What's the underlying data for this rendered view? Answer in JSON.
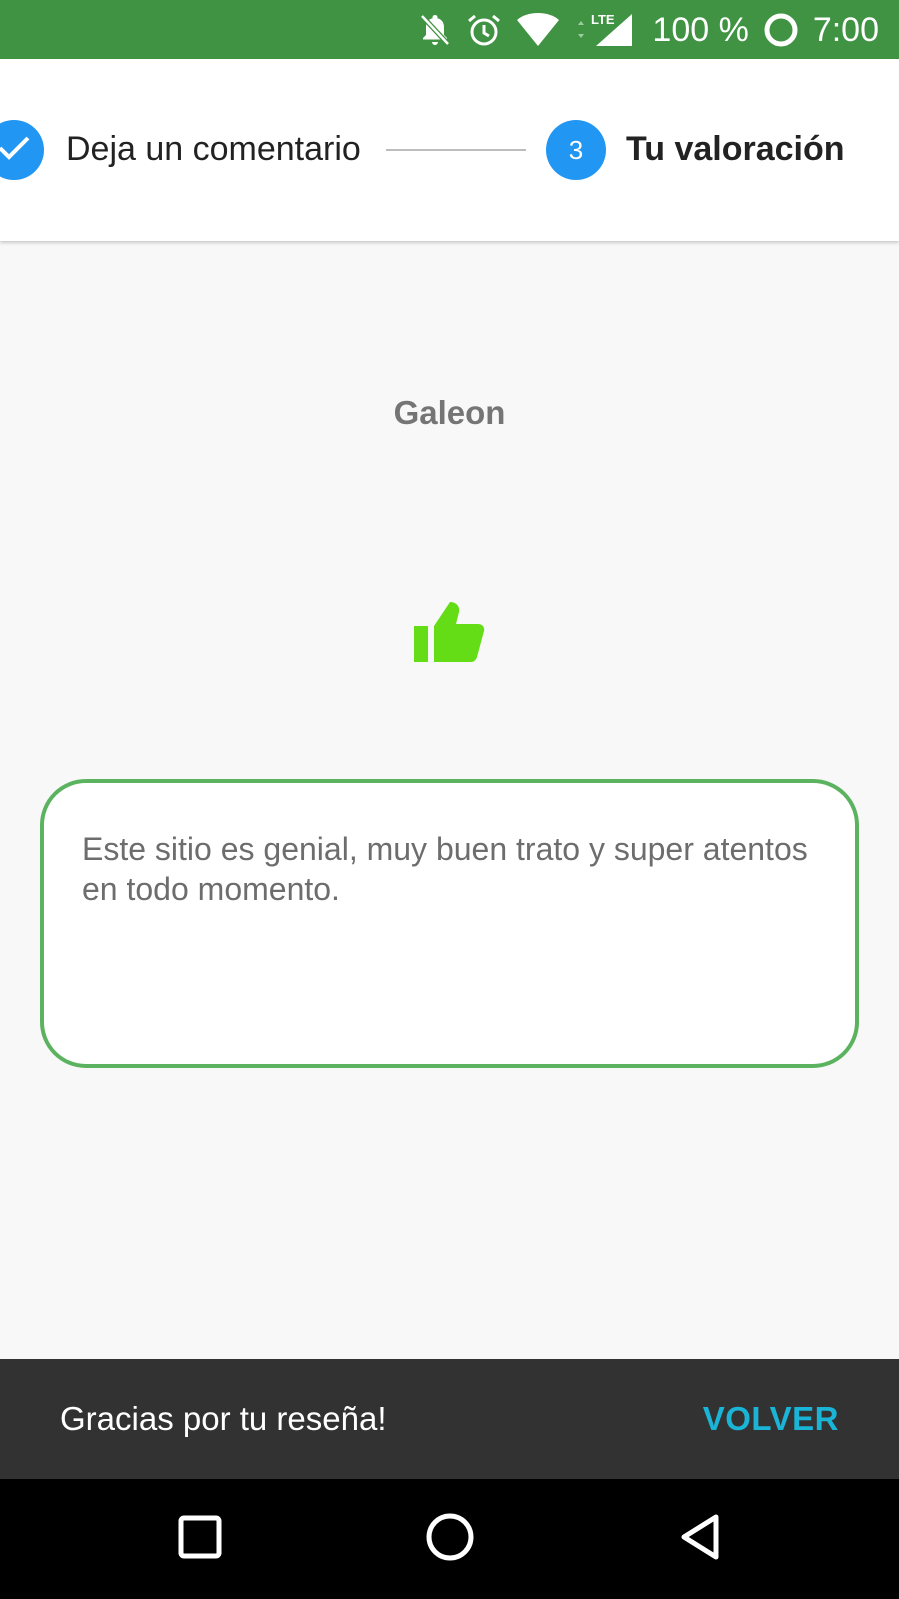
{
  "status_bar": {
    "icons": [
      "notifications-off-icon",
      "alarm-icon",
      "wifi-icon",
      "lte-signal-icon",
      "battery-saver-icon"
    ],
    "network_label": "LTE",
    "battery": "100 %",
    "time": "7:00",
    "color": "#3f9342"
  },
  "stepper": {
    "previous_step_label": "Deja un comentario",
    "current_step_number": "3",
    "current_step_label": "Tu valoración",
    "accent_color": "#2196f3"
  },
  "review": {
    "place_name": "Galeon",
    "rating_icon": "thumbs-up-icon",
    "rating_color": "#64dd17",
    "comment": "Este sitio es genial, muy buen trato y super atentos en todo momento.",
    "border_color": "#5cb35f"
  },
  "snackbar": {
    "message": "Gracias por tu reseña!",
    "action": "VOLVER",
    "action_color": "#1ab4d6"
  },
  "nav_bar": {
    "icons": [
      "recents-icon",
      "home-icon",
      "back-icon"
    ]
  }
}
